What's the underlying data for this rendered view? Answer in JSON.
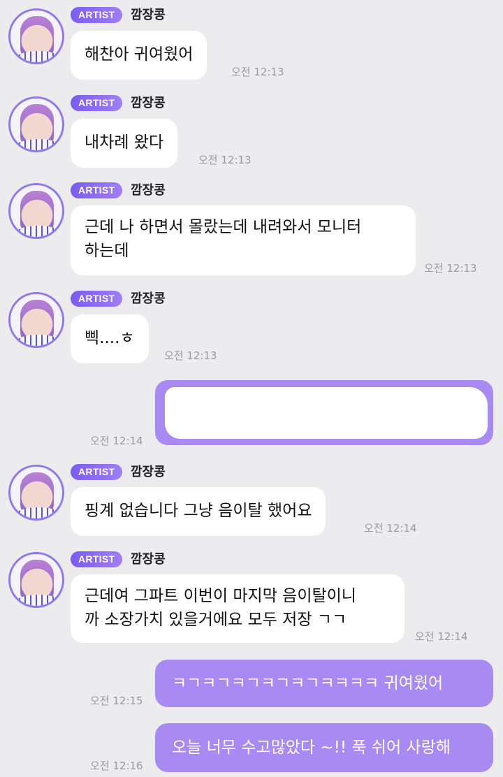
{
  "sender": {
    "badge": "ARTIST",
    "name": "깜장콩"
  },
  "messages": [
    {
      "text": "해찬아 귀여웠어",
      "time": "오전 12:13"
    },
    {
      "text": "내차례 왔다",
      "time": "오전 12:13"
    },
    {
      "text": "근데 나 하면서 몰랐는데 내려와서 모니터\n하는데",
      "time": "오전 12:13"
    },
    {
      "text": "삑....ㅎ",
      "time": "오전 12:13"
    },
    {
      "text": "핑계 없습니다 그냥 음이탈 했어요",
      "time": "오전 12:14"
    },
    {
      "text": "근데여 그파트 이번이 마지막 음이탈이니\n까 소장가치 있을거에요 모두 저장 ㄱㄱ",
      "time": "오전 12:14"
    }
  ],
  "my_messages": [
    {
      "text": "",
      "time": "오전 12:14",
      "redacted": true
    },
    {
      "text": "ㅋㄱㅋㄱㅋㄱㅋㄱㅋㄱㅋㅋㅋㅋ 귀여웠어",
      "time": "오전 12:15"
    },
    {
      "text": "오늘 너무 수고많았다 ~!! 푹 쉬어 사랑해",
      "time": "오전 12:16"
    }
  ],
  "colors": {
    "accent": "#a88af2",
    "badge": "#8b6cf2",
    "background": "#ececee"
  }
}
